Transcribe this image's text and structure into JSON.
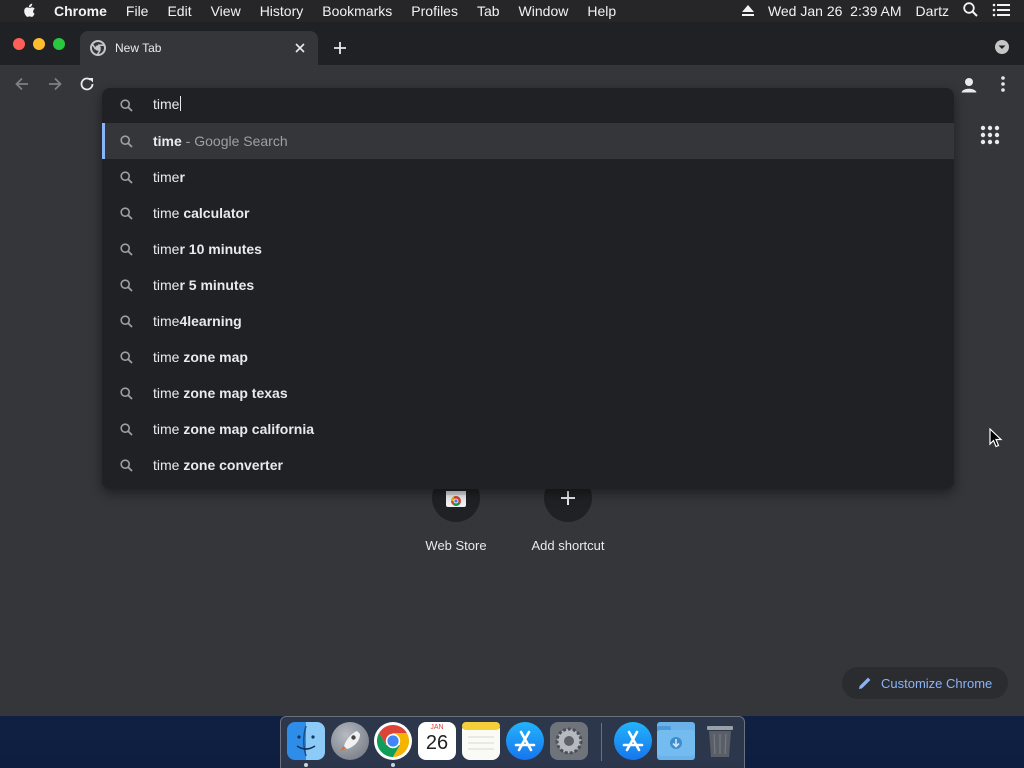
{
  "menubar": {
    "app_name": "Chrome",
    "items": [
      "File",
      "Edit",
      "View",
      "History",
      "Bookmarks",
      "Profiles",
      "Tab",
      "Window",
      "Help"
    ],
    "datetime": "Wed Jan 26  2:39 AM",
    "user": "Dartz"
  },
  "browser": {
    "tab_title": "New Tab"
  },
  "omnibox": {
    "query": "time",
    "suggestions": [
      {
        "base": "time",
        "ext": "",
        "suffix": " - Google Search"
      },
      {
        "base": "time",
        "ext": "r",
        "suffix": ""
      },
      {
        "base": "time",
        "ext": " calculator",
        "suffix": ""
      },
      {
        "base": "time",
        "ext": "r 10 minutes",
        "suffix": ""
      },
      {
        "base": "time",
        "ext": "r 5 minutes",
        "suffix": ""
      },
      {
        "base": "time",
        "ext": "4learning",
        "suffix": ""
      },
      {
        "base": "time",
        "ext": " zone map",
        "suffix": ""
      },
      {
        "base": "time",
        "ext": " zone map texas",
        "suffix": ""
      },
      {
        "base": "time",
        "ext": " zone map california",
        "suffix": ""
      },
      {
        "base": "time",
        "ext": " zone converter",
        "suffix": ""
      }
    ]
  },
  "newtab": {
    "shortcuts": [
      {
        "label": "Web Store",
        "icon": "webstore-icon"
      },
      {
        "label": "Add shortcut",
        "icon": "plus-icon"
      }
    ],
    "customize_label": "Customize Chrome"
  },
  "dock": {
    "calendar_month": "JAN",
    "calendar_day": "26",
    "apps": [
      "finder-icon",
      "launchpad-icon",
      "chrome-icon",
      "calendar-icon",
      "notes-icon",
      "app-store-icon",
      "system-preferences-icon",
      "app-store-download-icon",
      "downloads-folder-icon",
      "trash-icon"
    ]
  },
  "colors": {
    "accent": "#8ab4f8",
    "omnibox_bg": "#202124",
    "page_bg": "#35363a"
  }
}
